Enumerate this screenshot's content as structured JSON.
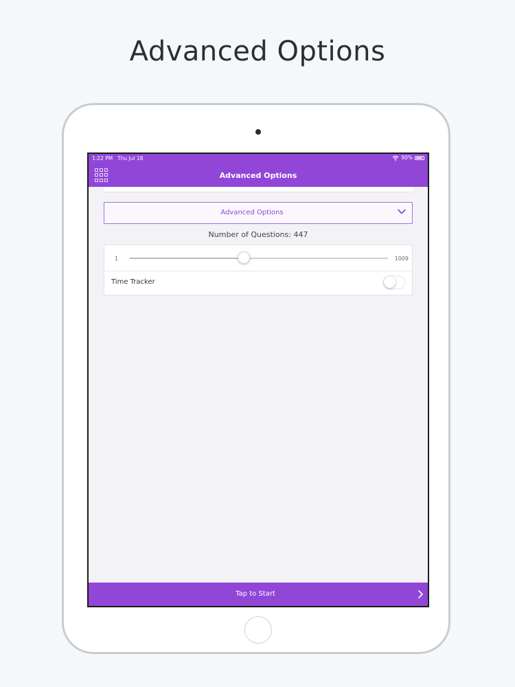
{
  "headline": "Advanced Options",
  "status_bar": {
    "time": "1:22 PM",
    "date": "Thu Jul 18",
    "battery": "90%"
  },
  "navbar": {
    "title": "Advanced Options",
    "menu_icon": "grid-icon"
  },
  "dropdown": {
    "label": "Advanced Options",
    "icon": "chevron-down-icon"
  },
  "questions": {
    "label": "Number of Questions: 447",
    "value": 447,
    "min": "1",
    "max": "1009"
  },
  "time_tracker": {
    "label": "Time Tracker",
    "enabled": false
  },
  "bottom_bar": {
    "label": "Tap to Start",
    "icon": "chevron-right-icon"
  },
  "colors": {
    "accent": "#9146d8",
    "background": "#f3f2f7"
  }
}
